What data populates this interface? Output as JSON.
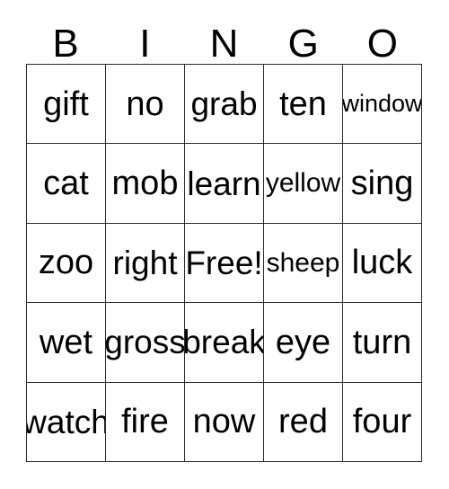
{
  "card": {
    "title": "BINGO",
    "header_letters": [
      "B",
      "I",
      "N",
      "G",
      "O"
    ],
    "free_space_label": "Free!",
    "grid": {
      "columns": 5,
      "rows": 5,
      "border_color": "#2b2b2b",
      "background_color": "#ffffff",
      "text_color": "#000000"
    },
    "cells": [
      [
        {
          "text": "gift",
          "size": "len-s"
        },
        {
          "text": "no",
          "size": "len-s"
        },
        {
          "text": "grab",
          "size": "len-m"
        },
        {
          "text": "ten",
          "size": "len-s"
        },
        {
          "text": "window",
          "size": "len-xl"
        }
      ],
      [
        {
          "text": "cat",
          "size": "len-s"
        },
        {
          "text": "mob",
          "size": "len-s"
        },
        {
          "text": "learn",
          "size": "len-m"
        },
        {
          "text": "yellow",
          "size": "len-l"
        },
        {
          "text": "sing",
          "size": "len-s"
        }
      ],
      [
        {
          "text": "zoo",
          "size": "len-s"
        },
        {
          "text": "right",
          "size": "len-m"
        },
        {
          "text": "Free!",
          "size": "len-m"
        },
        {
          "text": "sheep",
          "size": "len-l"
        },
        {
          "text": "luck",
          "size": "len-s"
        }
      ],
      [
        {
          "text": "wet",
          "size": "len-s"
        },
        {
          "text": "gross",
          "size": "len-m"
        },
        {
          "text": "break",
          "size": "len-m"
        },
        {
          "text": "eye",
          "size": "len-s"
        },
        {
          "text": "turn",
          "size": "len-s"
        }
      ],
      [
        {
          "text": "watch",
          "size": "len-m"
        },
        {
          "text": "fire",
          "size": "len-s"
        },
        {
          "text": "now",
          "size": "len-s"
        },
        {
          "text": "red",
          "size": "len-s"
        },
        {
          "text": "four",
          "size": "len-s"
        }
      ]
    ]
  }
}
